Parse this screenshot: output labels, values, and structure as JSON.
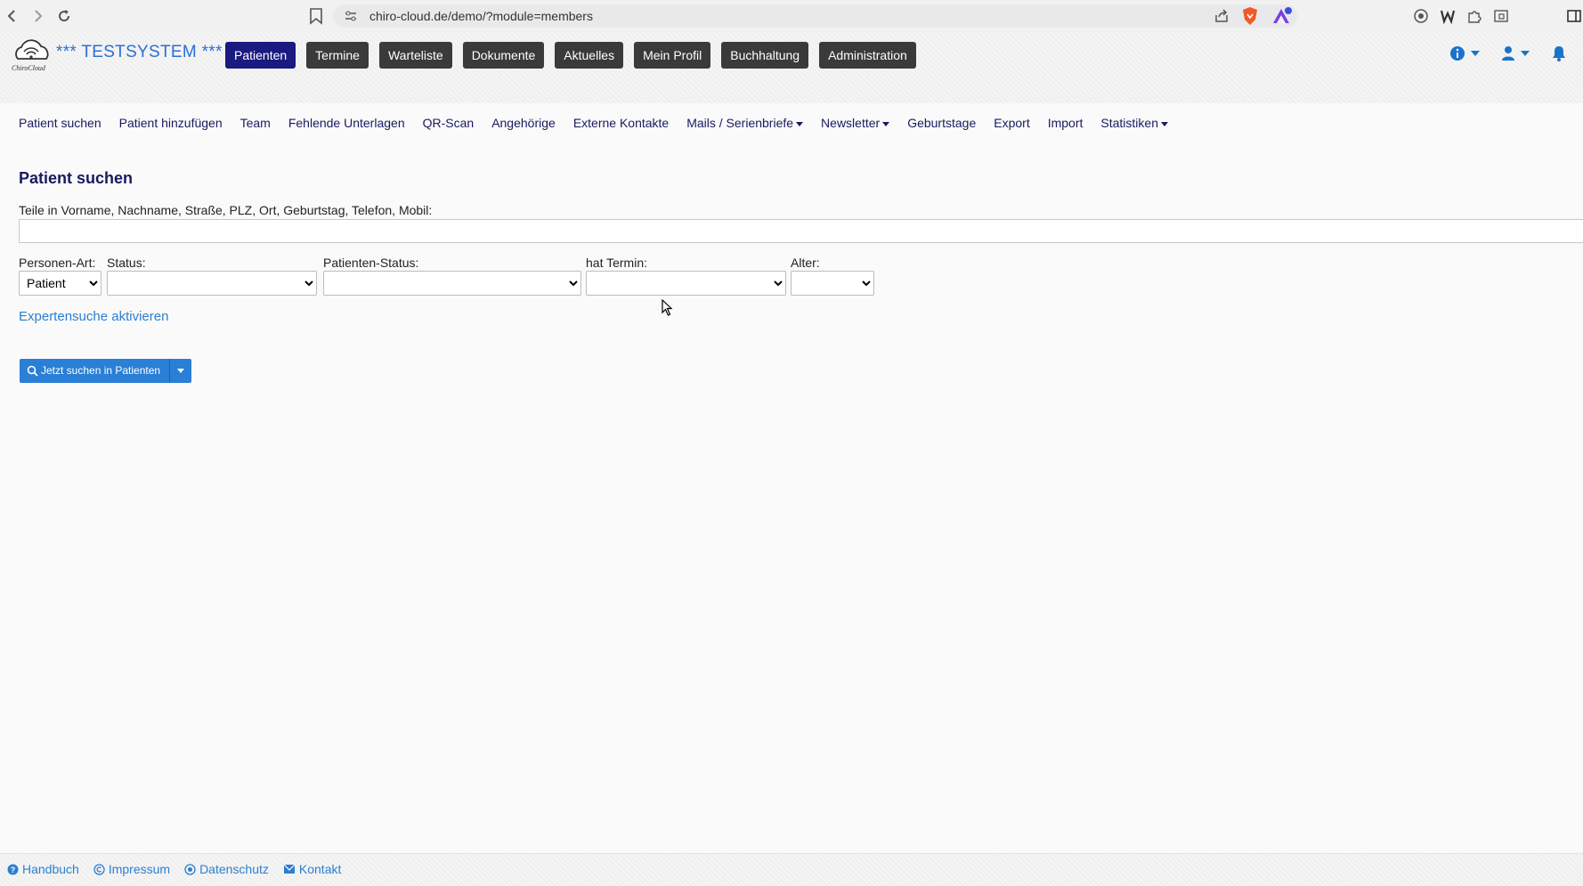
{
  "browser": {
    "url": "chiro-cloud.de/demo/?module=members"
  },
  "header": {
    "brand": "*** TESTSYSTEM ***",
    "tabs": [
      {
        "label": "Patienten",
        "active": true
      },
      {
        "label": "Termine"
      },
      {
        "label": "Warteliste"
      },
      {
        "label": "Dokumente"
      },
      {
        "label": "Aktuelles"
      },
      {
        "label": "Mein Profil"
      },
      {
        "label": "Buchhaltung"
      },
      {
        "label": "Administration"
      }
    ]
  },
  "subnav": {
    "items": [
      {
        "label": "Patient suchen"
      },
      {
        "label": "Patient hinzufügen"
      },
      {
        "label": "Team"
      },
      {
        "label": "Fehlende Unterlagen"
      },
      {
        "label": "QR-Scan"
      },
      {
        "label": "Angehörige"
      },
      {
        "label": "Externe Kontakte"
      },
      {
        "label": "Mails / Serienbriefe",
        "dropdown": true
      },
      {
        "label": "Newsletter",
        "dropdown": true
      },
      {
        "label": "Geburtstage"
      },
      {
        "label": "Export"
      },
      {
        "label": "Import"
      },
      {
        "label": "Statistiken",
        "dropdown": true
      }
    ]
  },
  "main": {
    "title": "Patient suchen",
    "search_label": "Teile in Vorname, Nachname, Straße, PLZ, Ort, Geburtstag, Telefon, Mobil:",
    "search_value": "",
    "filters": {
      "personen_art": {
        "label": "Personen-Art:",
        "value": "Patient"
      },
      "status": {
        "label": "Status:",
        "value": ""
      },
      "patienten_status": {
        "label": "Patienten-Status:",
        "value": ""
      },
      "hat_termin": {
        "label": "hat Termin:",
        "value": ""
      },
      "alter": {
        "label": "Alter:",
        "value": ""
      }
    },
    "expert_link": "Expertensuche aktivieren",
    "search_button": "Jetzt suchen in Patienten"
  },
  "footer": {
    "links": [
      {
        "label": "Handbuch",
        "icon": "help-icon"
      },
      {
        "label": "Impressum",
        "icon": "copyright-icon"
      },
      {
        "label": "Datenschutz",
        "icon": "privacy-icon"
      },
      {
        "label": "Kontakt",
        "icon": "mail-icon"
      }
    ]
  },
  "colors": {
    "active_tab": "#1a1a80",
    "tab": "#3a3a3a",
    "link": "#2a7fd0",
    "primary_button": "#2a7fd6",
    "title": "#1a1a60"
  }
}
